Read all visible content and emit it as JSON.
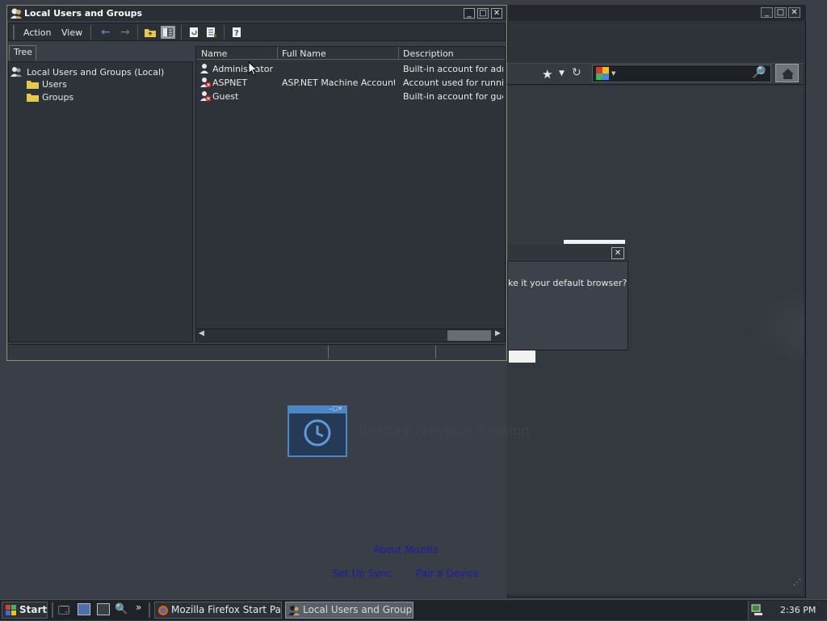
{
  "mmc": {
    "title": "Local Users and Groups",
    "menu": {
      "action": "Action",
      "view": "View"
    },
    "tree_tab": "Tree",
    "tree": {
      "root": "Local Users and Groups (Local)",
      "children": [
        "Users",
        "Groups"
      ]
    },
    "list": {
      "columns": [
        "Name",
        "Full Name",
        "Description"
      ],
      "rows": [
        {
          "name": "Administrator",
          "full_name": "",
          "description": "Built-in account for adminis"
        },
        {
          "name": "ASPNET",
          "full_name": "ASP.NET Machine Account",
          "description": "Account used for running"
        },
        {
          "name": "Guest",
          "full_name": "",
          "description": "Built-in account for guest a"
        }
      ]
    }
  },
  "firefox": {
    "dialog_text": "ke it your default browser?",
    "restore_session": "Restore Previous Session",
    "links": {
      "about": "About Mozilla",
      "sync": "Set Up Sync",
      "pair": "Pair a Device"
    }
  },
  "taskbar": {
    "start": "Start",
    "overflow": "»",
    "tasks": [
      "Mozilla Firefox Start Page...",
      "Local Users and Groups"
    ],
    "clock": "2:36 PM"
  },
  "colors": {
    "desktop": "#3a3f47",
    "window_border": "#8a8a6e",
    "link": "#1a1aa8"
  }
}
